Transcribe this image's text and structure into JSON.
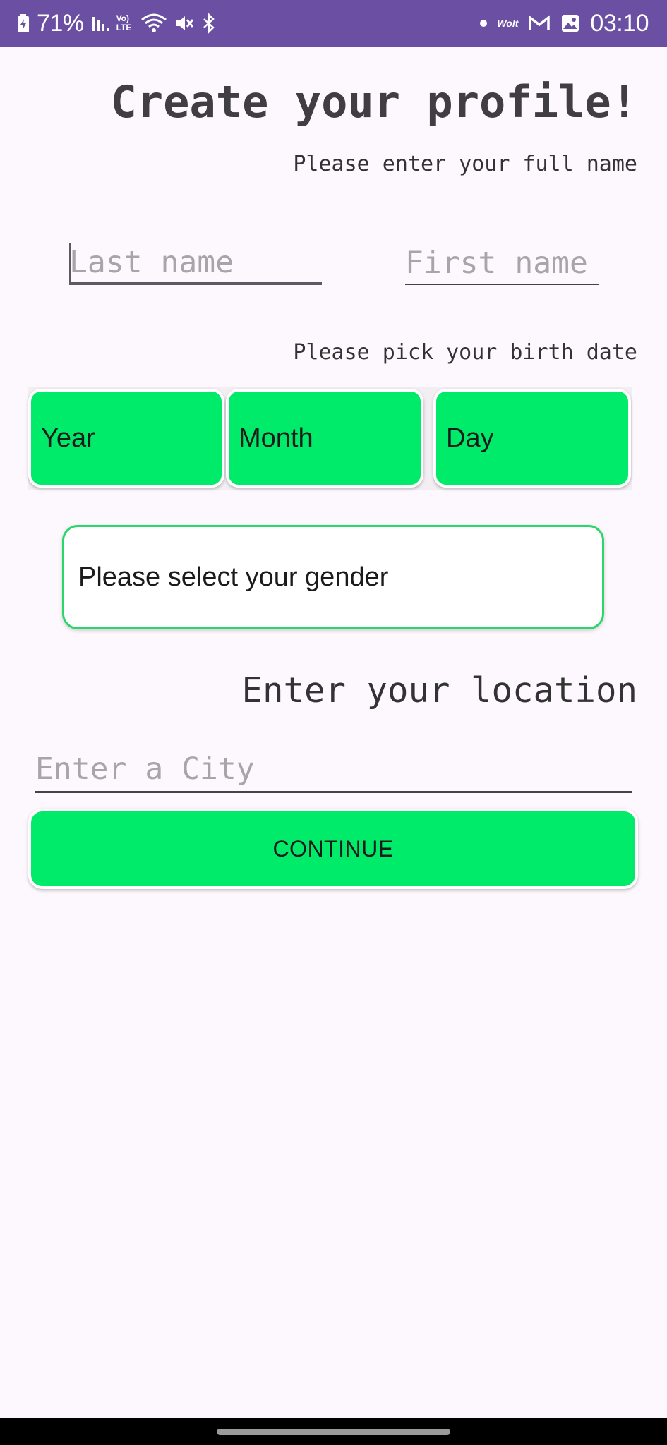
{
  "status_bar": {
    "battery": "71%",
    "volte": "Vo) LTE",
    "wolt_label": "Wolt",
    "time": "03:10",
    "icons": [
      "battery-charging-icon",
      "signal-icon",
      "volte-icon",
      "wifi-icon",
      "mute-icon",
      "bluetooth-icon",
      "notification-dot-icon",
      "wolt-icon",
      "gmail-icon",
      "gallery-icon"
    ]
  },
  "header": {
    "title": "Create your profile!",
    "name_prompt": "Please enter your full name"
  },
  "name_fields": {
    "last_name_placeholder": "Last name",
    "first_name_placeholder": "First name"
  },
  "birth_date": {
    "prompt": "Please pick your birth date",
    "year_label": "Year",
    "month_label": "Month",
    "day_label": "Day"
  },
  "gender": {
    "label": "Please select your gender"
  },
  "location": {
    "prompt": "Enter your location",
    "city_placeholder": "Enter a City"
  },
  "actions": {
    "continue_label": "CONTINUE"
  },
  "colors": {
    "status_bar": "#6a4fa2",
    "accent_green": "#00eb6a",
    "background": "#fdf8fd"
  }
}
